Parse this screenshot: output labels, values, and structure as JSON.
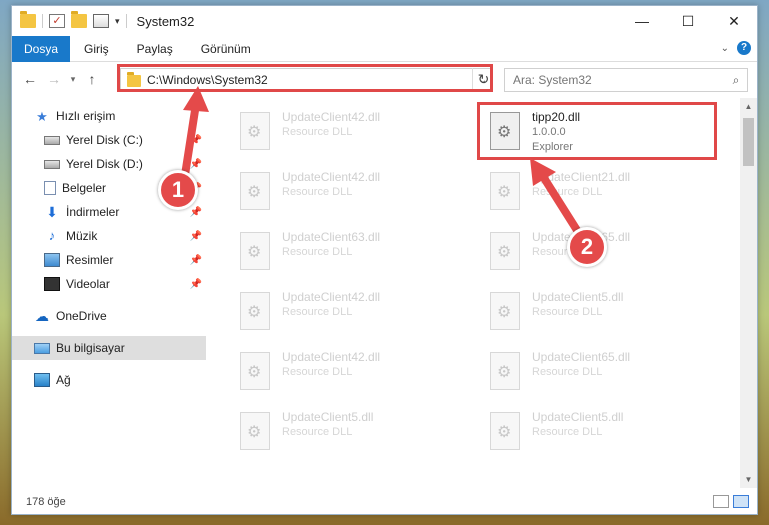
{
  "window": {
    "title": "System32",
    "controls": {
      "minimize": "—",
      "maximize": "☐",
      "close": "✕"
    }
  },
  "ribbon": {
    "tabs": [
      "Dosya",
      "Giriş",
      "Paylaş",
      "Görünüm"
    ],
    "help": "?"
  },
  "nav": {
    "back": "←",
    "forward": "→",
    "history": "▾",
    "up": "↑",
    "address": "C:\\Windows\\System32",
    "refresh": "↻",
    "search_placeholder": "Ara: System32"
  },
  "sidebar": {
    "items": [
      {
        "label": "Hızlı erişim",
        "icon": "star-icon"
      },
      {
        "label": "Yerel Disk (C:)",
        "icon": "drive-icon",
        "pinned": true
      },
      {
        "label": "Yerel Disk (D:)",
        "icon": "drive-icon",
        "pinned": true
      },
      {
        "label": "Belgeler",
        "icon": "documents-icon",
        "pinned": true
      },
      {
        "label": "İndirmeler",
        "icon": "download-icon",
        "pinned": true
      },
      {
        "label": "Müzik",
        "icon": "music-icon",
        "pinned": true
      },
      {
        "label": "Resimler",
        "icon": "pictures-icon",
        "pinned": true
      },
      {
        "label": "Videolar",
        "icon": "videos-icon",
        "pinned": true
      },
      {
        "label": "OneDrive",
        "icon": "onedrive-icon"
      },
      {
        "label": "Bu bilgisayar",
        "icon": "this-pc-icon",
        "selected": true
      },
      {
        "label": "Ağ",
        "icon": "network-icon"
      }
    ]
  },
  "files": [
    {
      "name": "UpdateClient42.dll",
      "desc": "Resource DLL"
    },
    {
      "name": "tipp20.dll",
      "desc": "1.0.0.0",
      "extra": "Explorer",
      "active": true
    },
    {
      "name": "UpdateClient42.dll",
      "desc": "Resource DLL"
    },
    {
      "name": "UpdateClient21.dll",
      "desc": "Resource DLL"
    },
    {
      "name": "UpdateClient63.dll",
      "desc": "Resource DLL"
    },
    {
      "name": "UpdateClient65.dll",
      "desc": "Resource DLL"
    },
    {
      "name": "UpdateClient42.dll",
      "desc": "Resource DLL"
    },
    {
      "name": "UpdateClient5.dll",
      "desc": "Resource DLL"
    },
    {
      "name": "UpdateClient42.dll",
      "desc": "Resource DLL"
    },
    {
      "name": "UpdateClient65.dll",
      "desc": "Resource DLL"
    },
    {
      "name": "UpdateClient5.dll",
      "desc": "Resource DLL"
    },
    {
      "name": "UpdateClient5.dll",
      "desc": "Resource DLL"
    }
  ],
  "status": {
    "count": "178 öğe"
  },
  "callouts": {
    "one": "1",
    "two": "2"
  },
  "colors": {
    "accent": "#1979ca",
    "annotation": "#e04848"
  }
}
